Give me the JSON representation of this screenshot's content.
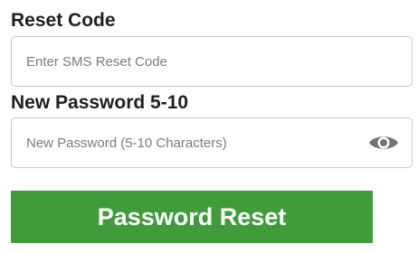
{
  "reset_code": {
    "label": "Reset Code",
    "placeholder": "Enter SMS Reset Code",
    "value": ""
  },
  "new_password": {
    "label": "New Password 5-10",
    "placeholder": "New Password (5-10 Characters)",
    "value": "",
    "toggle_icon": "eye-icon"
  },
  "submit": {
    "label": "Password Reset",
    "color": "#409c3a"
  }
}
